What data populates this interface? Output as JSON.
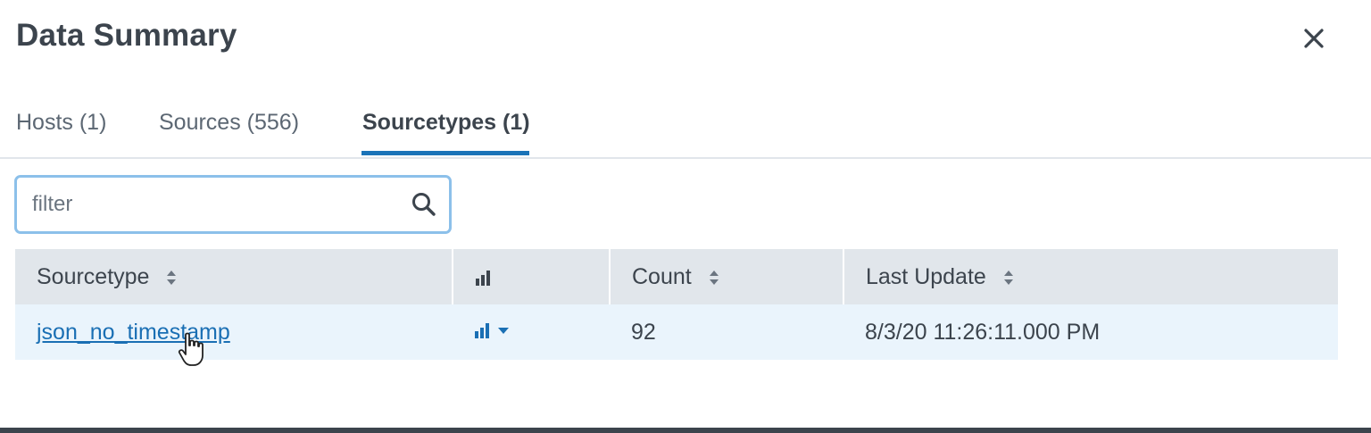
{
  "dialog": {
    "title": "Data Summary",
    "close_icon": "close-icon"
  },
  "tabs": [
    {
      "label": "Hosts (1)",
      "active": false
    },
    {
      "label": "Sources (556)",
      "active": false
    },
    {
      "label": "Sourcetypes (1)",
      "active": true
    }
  ],
  "filter": {
    "placeholder": "filter",
    "value": "",
    "icon": "search-icon"
  },
  "table": {
    "columns": [
      {
        "label": "Sourcetype",
        "sortable": true
      },
      {
        "label": "",
        "icon": "bar-chart-icon",
        "sortable": false
      },
      {
        "label": "Count",
        "sortable": true
      },
      {
        "label": "Last Update",
        "sortable": true
      }
    ],
    "rows": [
      {
        "sourcetype": "json_no_timestamp",
        "chart_icon": "bar-chart-icon",
        "count": "92",
        "last_update": "8/3/20 11:26:11.000 PM"
      }
    ]
  },
  "colors": {
    "accent": "#1a73b8",
    "link": "#1a6fb4",
    "header_bg": "#e1e6eb",
    "row_highlight": "#eaf4fc",
    "filter_border": "#8cc0ea"
  }
}
